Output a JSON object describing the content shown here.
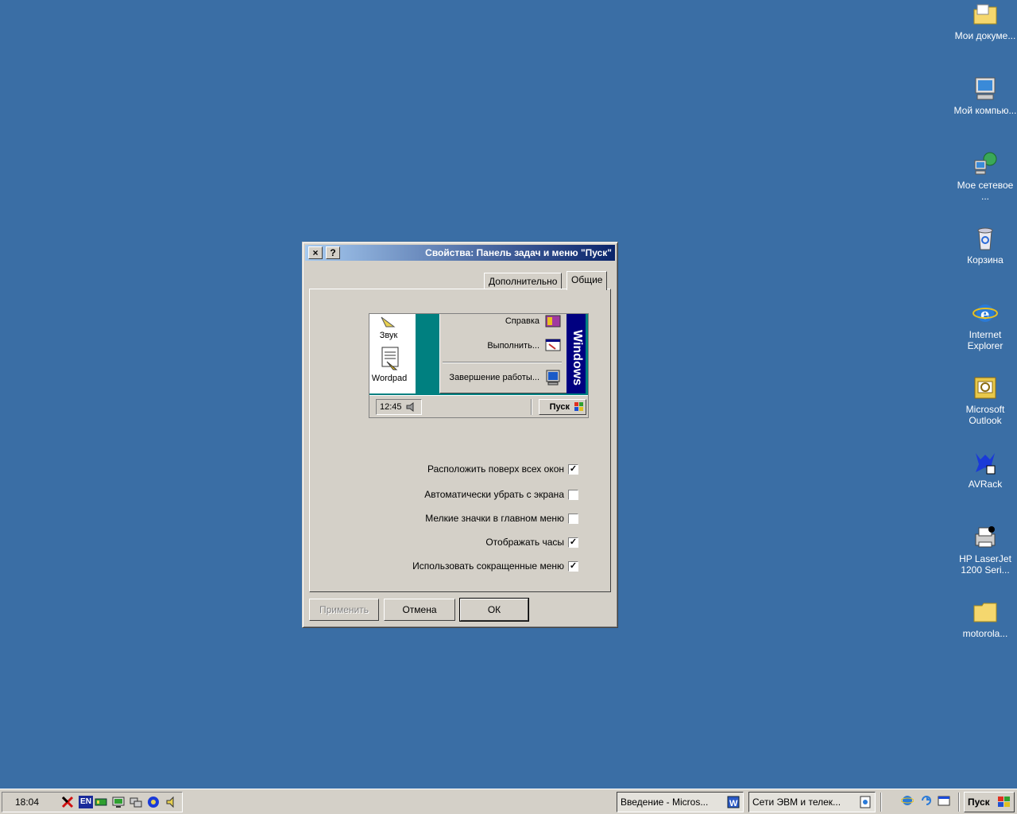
{
  "desktop": {
    "icons": [
      {
        "label": "Мои докуме...",
        "icon": "my-documents-folder-icon"
      },
      {
        "label": "Мой компью...",
        "icon": "my-computer-icon"
      },
      {
        "label": "Мое сетевое ...",
        "icon": "network-places-icon"
      },
      {
        "label": "Корзина",
        "icon": "recycle-bin-icon"
      },
      {
        "label": "Internet Explorer",
        "icon": "internet-explorer-icon"
      },
      {
        "label": "Microsoft Outlook",
        "icon": "outlook-icon"
      },
      {
        "label": "AVRack",
        "icon": "avrack-icon"
      },
      {
        "label": "HP LaserJet 1200 Seri...",
        "icon": "printer-icon"
      },
      {
        "label": "motorola...",
        "icon": "folder-icon"
      }
    ]
  },
  "dialog": {
    "title": "Свойства: Панель задач и меню \"Пуск\"",
    "help_label": "?",
    "close_label": "×",
    "tabs": [
      {
        "label": "Общие",
        "active": true
      },
      {
        "label": "Дополнительно",
        "active": false
      }
    ],
    "preview": {
      "menu_items": [
        "Справка",
        "Выполнить...",
        "Завершение работы..."
      ],
      "brand": "Windows",
      "desktop_items": [
        "Звук",
        "Wordpad"
      ],
      "start_label": "Пуск",
      "clock": "12:45"
    },
    "options": [
      {
        "label": "Расположить поверх всех окон",
        "checked": true
      },
      {
        "label": "Автоматически убрать с экрана",
        "checked": false
      },
      {
        "label": "Мелкие значки в главном меню",
        "checked": false
      },
      {
        "label": "Отображать часы",
        "checked": true
      },
      {
        "label": "Использовать сокращенные меню",
        "checked": true
      }
    ],
    "buttons": {
      "ok": "ОК",
      "cancel": "Отмена",
      "apply": "Применить"
    }
  },
  "taskbar": {
    "start_label": "Пуск",
    "tasks": [
      {
        "label": "Сети ЭВМ и телек...",
        "icon": "network-doc-icon"
      },
      {
        "label": "Введение - Micros...",
        "icon": "word-doc-icon"
      }
    ],
    "tray": {
      "clock": "18:04",
      "language": "EN"
    }
  },
  "colors": {
    "desktop": "#3a6ea5",
    "titlebar_dark": "#0a246a",
    "titlebar_light": "#a6caf0",
    "face": "#d4d0c8"
  }
}
